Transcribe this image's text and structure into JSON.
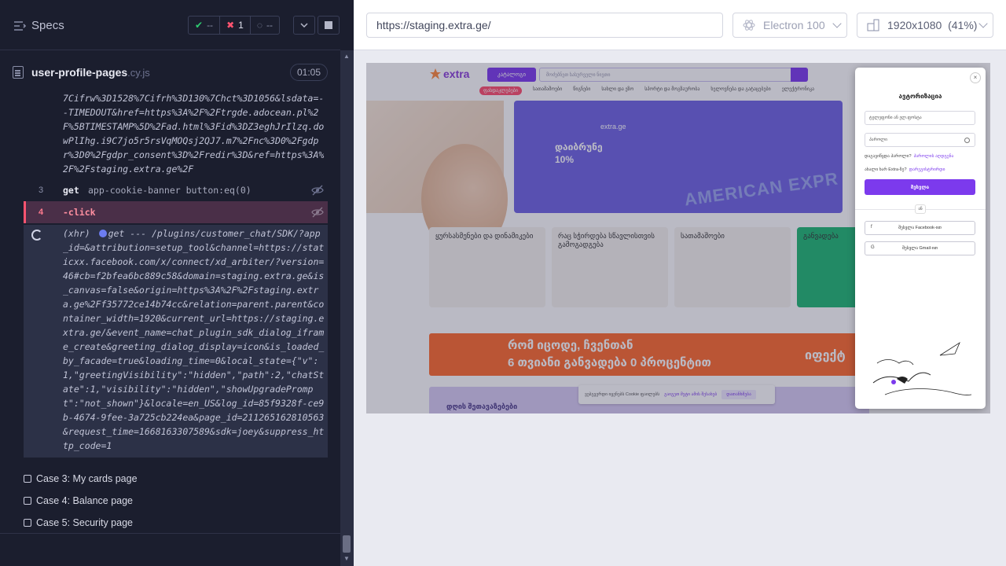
{
  "sidebar": {
    "title": "Specs",
    "stats": {
      "passed": "--",
      "failed": "1",
      "pending": "--"
    },
    "file": {
      "name": "user-profile-pages",
      "ext": ".cy.js",
      "duration": "01:05"
    },
    "url_fragment": "7Cifrw%3D1528%7Cifrh%3D130%7Chct%3D1056&lsdata=--TIMEDOUT&href=https%3A%2F%2Ftrgde.adocean.pl%2F%5BTIMESTAMP%5D%2Fad.html%3Fid%3DZ3eghJrIlzq.dowPlIhg.i9C7jo5r5rsVqMOQsj2QJ7.m7%2Fnc%3D0%2Fgdpr%3D0%2Fgdpr_consent%3D%2Fredir%3D&ref=https%3A%2F%2Fstaging.extra.ge%2F",
    "commands": [
      {
        "line": "3",
        "name": "get",
        "arg": "app-cookie-banner button:eq(0)"
      },
      {
        "line": "4",
        "name": "-click",
        "arg": ""
      }
    ],
    "xhr": {
      "label": "(xhr)",
      "method": "get",
      "status": "---",
      "url": "/plugins/customer_chat/SDK/?app_id=&attribution=setup_tool&channel=https://staticxx.facebook.com/x/connect/xd_arbiter/?version=46#cb=f2bfea6bc889c58&domain=staging.extra.ge&is_canvas=false&origin=https%3A%2F%2Fstaging.extra.ge%2Ff35772ce14b74cc&relation=parent.parent&container_width=1920&current_url=https://staging.extra.ge/&event_name=chat_plugin_sdk_dialog_iframe_create&greeting_dialog_display=icon&is_loaded_by_facade=true&loading_time=0&local_state={\"v\":1,\"greetingVisibility\":\"hidden\",\"path\":2,\"chatState\":1,\"visibility\":\"hidden\",\"showUpgradePrompt\":\"not_shown\"}&locale=en_US&log_id=85f9328f-ce9b-4674-9fee-3a725cb224ea&page_id=211265162810563&request_time=1668163307589&sdk=joey&suppress_http_code=1"
    },
    "cases": [
      "Case 3: My cards page",
      "Case 4: Balance page",
      "Case 5: Security page"
    ]
  },
  "preview": {
    "url": "https://staging.extra.ge/",
    "browser": "Electron 100",
    "viewport": "1920x1080",
    "scale": "(41%)"
  },
  "site": {
    "logo": "extra",
    "catalog_button": "კატალოგი",
    "search_placeholder": "მოძებნეთ სასურველი ნივთი",
    "nav": [
      "ფასდაკლებები",
      "სათამაშოები",
      "წიგნები",
      "სახლი და ეზო",
      "სპორტი და მოგზაურობა",
      "ხელოვნება და გატაცებები",
      "ელექტრონიკა"
    ],
    "hero_logo": "extra.ge",
    "hero_title": "დაიბრუნე",
    "hero_sub": "10%",
    "hero_amex": "AMERICAN EXPR",
    "cards": [
      "ყურსასმენები და დინამიკები",
      "რაც სჭირდება სწავლისთვის გამოგადგება",
      "სათამაშოები",
      "განვადება"
    ],
    "banner_l1": "რომ იცოდე, ჩვენთან",
    "banner_l2": "6 თვიანი განვადება 0 პროცენტით",
    "banner_right": "იფექტ",
    "banner2_text": "დღის შეთავაზებები",
    "cookie_text": "ვებგვერდი იყენებს Cookie ფაილებს",
    "cookie_link": "გაიგეთ მეტი ამის შესახებ",
    "cookie_btn": "დათანხმება"
  },
  "modal": {
    "title": "ავტორიზაცია",
    "email_placeholder": "ტელეფონი ან ელ.ფოსტა",
    "password_placeholder": "პაროლი",
    "forgot_text": "დაგავიწყდა პაროლი?",
    "forgot_link": "პაროლის აღდგენა",
    "register_text": "ახალი ხარ Extra-ზე?",
    "register_link": "დარეგისტრირდი",
    "submit": "შესვლა",
    "or": "ან",
    "facebook": "შესვლა Facebook-ით",
    "gmail": "შესვლა Gmail-ით",
    "close": "×"
  },
  "colors": {
    "accent": "#7c3aed",
    "fail": "#ff5470",
    "pass": "#2ecc71"
  }
}
